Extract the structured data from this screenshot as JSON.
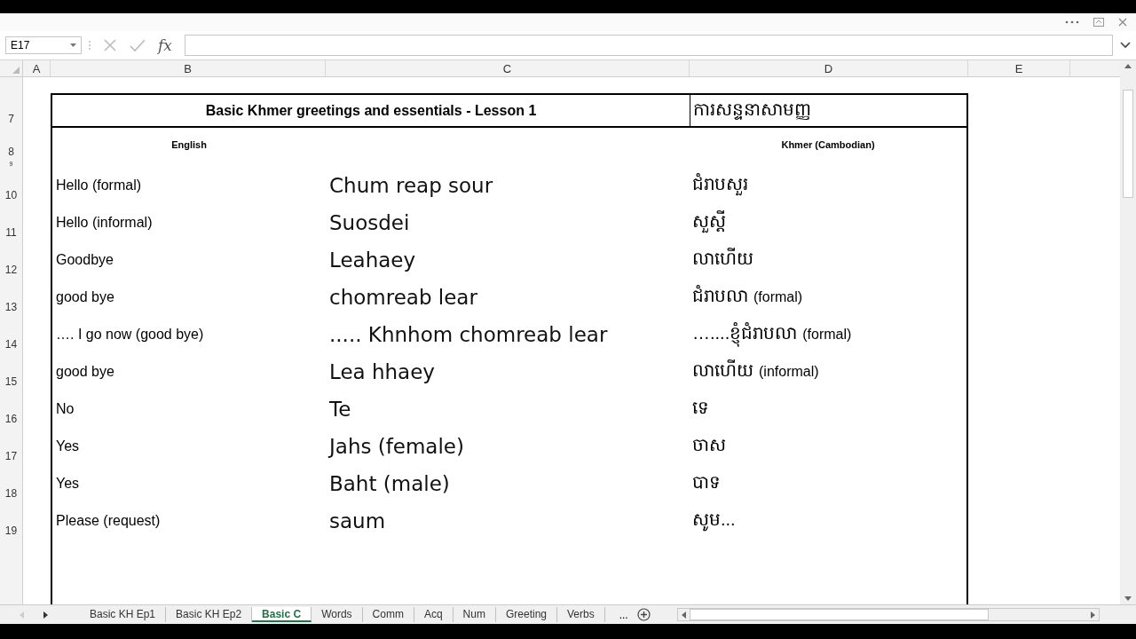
{
  "name_box": "E17",
  "formula_bar": {
    "function_label": "fx"
  },
  "columns": [
    "A",
    "B",
    "C",
    "D",
    "E"
  ],
  "rows": [
    {
      "number": "7",
      "kind": "title",
      "title": "Basic Khmer greetings and essentials - Lesson 1",
      "khmer": "ការសន្ទនាសាមញ្ញ"
    },
    {
      "number": "8",
      "kind": "header",
      "english": "English",
      "khmer": "Khmer (Cambodian)"
    },
    {
      "number": "9",
      "kind": "spacer"
    },
    {
      "number": "10",
      "kind": "entry",
      "english": "Hello (formal)",
      "romanized": "Chum reap sour",
      "khmer": "ជំរាបសួរ"
    },
    {
      "number": "11",
      "kind": "entry",
      "english": "Hello (informal)",
      "romanized": "Suosdei",
      "khmer": "សួស្តី"
    },
    {
      "number": "12",
      "kind": "entry",
      "english": "Goodbye",
      "romanized": "Leahaey",
      "khmer": "លាហើយ"
    },
    {
      "number": "13",
      "kind": "entry",
      "english": "good bye",
      "romanized": "chomreab lear",
      "khmer": "ជំរាបលា",
      "note": "(formal)"
    },
    {
      "number": "14",
      "kind": "entry",
      "english": "…. I go now (good bye)",
      "romanized": "..... Khnhom chomreab lear",
      "khmer": "…....ខ្ញុំជំរាបលា",
      "note": "(formal)"
    },
    {
      "number": "15",
      "kind": "entry",
      "english": "good bye",
      "romanized": "Lea hhaey",
      "khmer": "លាហើយ",
      "note": "(informal)"
    },
    {
      "number": "16",
      "kind": "entry",
      "english": "No",
      "romanized": "Te",
      "khmer": "ទេ"
    },
    {
      "number": "17",
      "kind": "entry",
      "english": "Yes",
      "romanized": "Jahs (female)",
      "khmer": "ចាស"
    },
    {
      "number": "18",
      "kind": "entry",
      "english": "Yes",
      "romanized": "Baht (male)",
      "khmer": "បាទ"
    },
    {
      "number": "19",
      "kind": "entry",
      "english": "Please (request)",
      "romanized": "saum",
      "khmer": "សូម..."
    },
    {
      "number": "",
      "kind": "blank"
    }
  ],
  "sheet_tabs": [
    {
      "label": "Basic KH Ep1",
      "selected": false
    },
    {
      "label": "Basic KH Ep2",
      "selected": false
    },
    {
      "label": "Basic C",
      "selected": true
    },
    {
      "label": "Words",
      "selected": false
    },
    {
      "label": "Comm",
      "selected": false
    },
    {
      "label": "Acq",
      "selected": false
    },
    {
      "label": "Num",
      "selected": false
    },
    {
      "label": "Greeting",
      "selected": false
    },
    {
      "label": "Verbs",
      "selected": false
    }
  ],
  "more_tabs": "..."
}
